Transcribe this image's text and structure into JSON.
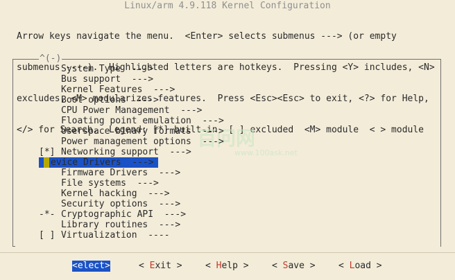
{
  "window": {
    "title": "Linux/arm 4.9.118 Kernel Configuration"
  },
  "help_lines": [
    "Arrow keys navigate the menu.  <Enter> selects submenus ---> (or empty",
    "submenus ----).  Highlighted letters are hotkeys.  Pressing <Y> includes, <N>",
    "excludes, <M> modularizes features.  Press <Esc><Esc> to exit, <?> for Help,",
    "</> for Search.  Legend: [*] built-in  [ ] excluded  <M> module  < > module"
  ],
  "scroll_indicator": "^(-)",
  "menu": {
    "items": [
      {
        "mark": "",
        "hot": "S",
        "rest": "ystem Type  --->"
      },
      {
        "mark": "",
        "hot": "B",
        "rest": "us support  --->"
      },
      {
        "mark": "",
        "hot": "K",
        "rest": "ernel Features  --->"
      },
      {
        "mark": "",
        "hot": "B",
        "rest": "oot options  --->"
      },
      {
        "mark": "",
        "hot": "C",
        "rest": "PU Power Management  --->"
      },
      {
        "mark": "",
        "hot": "F",
        "rest": "loating point emulation  --->"
      },
      {
        "mark": "",
        "hot": "U",
        "rest": "serspace binary formats  --->"
      },
      {
        "mark": "",
        "hot": "P",
        "rest": "ower management options  --->"
      },
      {
        "mark": "[*]",
        "hot": "N",
        "rest": "etworking support  --->"
      },
      {
        "mark": "",
        "hot": "D",
        "rest": "evice Drivers  --->",
        "selected": true
      },
      {
        "mark": "",
        "hot": "F",
        "rest": "irmware Drivers  --->"
      },
      {
        "mark": "",
        "hot": "F",
        "rest": "ile systems  --->"
      },
      {
        "mark": "",
        "hot": "K",
        "rest": "ernel hacking  --->"
      },
      {
        "mark": "",
        "hot": "S",
        "rest": "ecurity options  --->"
      },
      {
        "mark": "-*-",
        "hot": "C",
        "rest": "ryptographic API  --->"
      },
      {
        "mark": "",
        "hot": "L",
        "rest": "ibrary routines  --->"
      },
      {
        "mark": "[ ]",
        "hot": "V",
        "rest": "irtualization  ----"
      }
    ]
  },
  "buttons": {
    "select": {
      "open": "<",
      "key": "S",
      "rest": "elect",
      "close": ">"
    },
    "exit": {
      "open": "< ",
      "key": "E",
      "rest": "xit",
      "close": " >"
    },
    "help": {
      "open": "< ",
      "key": "H",
      "rest": "elp",
      "close": " >"
    },
    "save": {
      "open": "< ",
      "key": "S",
      "rest": "ave",
      "close": " >"
    },
    "load": {
      "open": "< ",
      "key": "L",
      "rest": "oad",
      "close": " >"
    }
  },
  "watermark": {
    "text": "百问网",
    "url": "www.100ask.net"
  },
  "colors": {
    "background": "#f3ecd9",
    "selection": "#1b52c6",
    "cursor": "#b6aa00",
    "hotkey": "#c0392b"
  }
}
